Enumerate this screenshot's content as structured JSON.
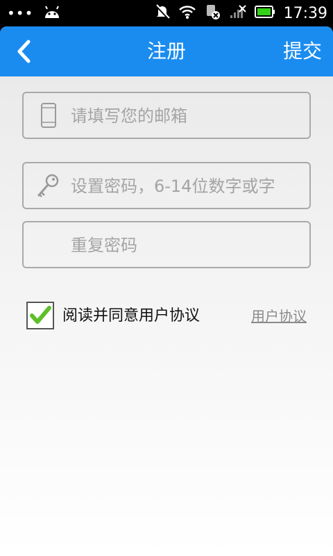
{
  "status_bar": {
    "dots": "•••",
    "time": "17:39"
  },
  "nav": {
    "title": "注册",
    "submit_label": "提交"
  },
  "form": {
    "email_placeholder": "请填写您的邮箱",
    "password_placeholder": "设置密码，6-14位数字或字",
    "repeat_placeholder": "重复密码"
  },
  "agreement": {
    "checked": true,
    "label": "阅读并同意用户协议",
    "link_label": "用户协议"
  },
  "colors": {
    "nav_bar": "#1a8cf0",
    "check_mark": "#5fbf2a"
  }
}
